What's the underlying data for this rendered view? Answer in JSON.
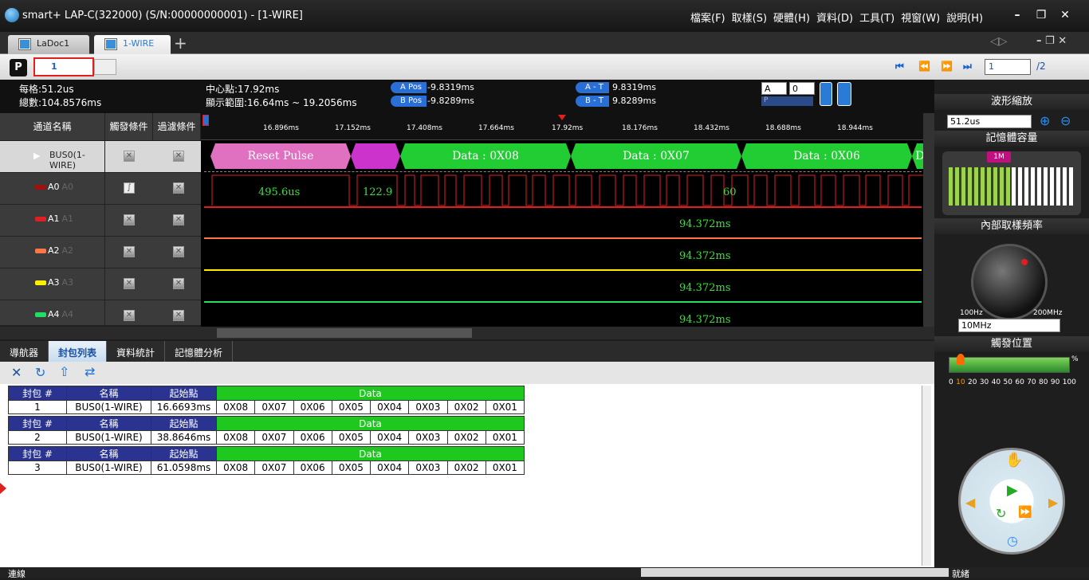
{
  "window": {
    "app_title": "smart+  LAP-C(322000) (S/N:00000000001) - [1-WIRE]"
  },
  "menu": [
    "檔案(F)",
    "取樣(S)",
    "硬體(H)",
    "資料(D)",
    "工具(T)",
    "視窗(W)",
    "說明(H)"
  ],
  "tabs": [
    {
      "label": "LaDoc1"
    },
    {
      "label": "1-WIRE"
    }
  ],
  "toolbar": {
    "p_label": "P",
    "page_current": "1",
    "page_input": "1",
    "page_total": "/2"
  },
  "info": {
    "per_div": "每格:51.2us",
    "total": "總數:104.8576ms",
    "center": "中心點:17.92ms",
    "range": "顯示範圍:16.64ms ~ 19.2056ms",
    "a_pos_label": "A Pos",
    "a_pos": "-9.8319ms",
    "b_pos_label": "B Pos",
    "b_pos": "-9.8289ms",
    "a_t_label": "A - T",
    "a_t": "9.8319ms",
    "b_t_label": "B - T",
    "b_t": "9.8289ms",
    "cursor_sel": "A",
    "cursor_num": "0",
    "p_label": "P"
  },
  "channels": {
    "headers": [
      "通道名稱",
      "觸發條件",
      "過濾條件"
    ],
    "rows": [
      {
        "name": "BUS0(1-WIRE)",
        "sub": ""
      },
      {
        "name": "A0",
        "sub": "A0"
      },
      {
        "name": "A1",
        "sub": "A1"
      },
      {
        "name": "A2",
        "sub": "A2"
      },
      {
        "name": "A3",
        "sub": "A3"
      },
      {
        "name": "A4",
        "sub": "A4"
      }
    ]
  },
  "ruler": [
    "16.896ms",
    "17.152ms",
    "17.408ms",
    "17.664ms",
    "17.92ms",
    "18.176ms",
    "18.432ms",
    "18.688ms",
    "18.944ms"
  ],
  "bus_segments": [
    "Reset Pulse",
    "",
    "Data : 0X08",
    "Data : 0X07",
    "Data : 0X06",
    "D"
  ],
  "a0_labels": [
    "495.6us",
    "122.9",
    "60"
  ],
  "channel_measure": [
    "94.372ms",
    "94.372ms",
    "94.372ms",
    "94.372ms"
  ],
  "bottom_tabs": [
    "導航器",
    "封包列表",
    "資料統計",
    "記憶體分析"
  ],
  "packet_table": {
    "headers": [
      "封包 #",
      "名稱",
      "起始點",
      "Data"
    ],
    "rows": [
      {
        "id": "1",
        "name": "BUS0(1-WIRE)",
        "start": "16.6693ms",
        "data": [
          "0X08",
          "0X07",
          "0X06",
          "0X05",
          "0X04",
          "0X03",
          "0X02",
          "0X01"
        ]
      },
      {
        "id": "2",
        "name": "BUS0(1-WIRE)",
        "start": "38.8646ms",
        "data": [
          "0X08",
          "0X07",
          "0X06",
          "0X05",
          "0X04",
          "0X03",
          "0X02",
          "0X01"
        ]
      },
      {
        "id": "3",
        "name": "BUS0(1-WIRE)",
        "start": "61.0598ms",
        "data": [
          "0X08",
          "0X07",
          "0X06",
          "0X05",
          "0X04",
          "0X03",
          "0X02",
          "0X01"
        ]
      }
    ]
  },
  "status": {
    "left": "連線",
    "right": "就緒"
  },
  "right_panel": {
    "zoom_title": "波形縮放",
    "zoom_value": "51.2us",
    "memory_title": "記憶體容量",
    "memory_badge": "1M",
    "memory_level": 0.5,
    "freq_title": "內部取樣頻率",
    "freq_min": "100Hz",
    "freq_max": "200MHz",
    "freq_value": "10MHz",
    "trigger_title": "觸發位置",
    "trigger_pct": "%",
    "trigger_value": 10,
    "trigger_scale": [
      "0",
      "10",
      "20",
      "30",
      "40",
      "50",
      "60",
      "70",
      "80",
      "90",
      "100"
    ]
  },
  "colors": {
    "accent": "#2a7bd5",
    "bus_green": "#22cc33",
    "reset_pink": "#e070c0",
    "a0": "#e02020",
    "a1": "#ff7744",
    "a2": "#ffee00",
    "a3": "#22dd66",
    "a4": "#22aaff"
  }
}
